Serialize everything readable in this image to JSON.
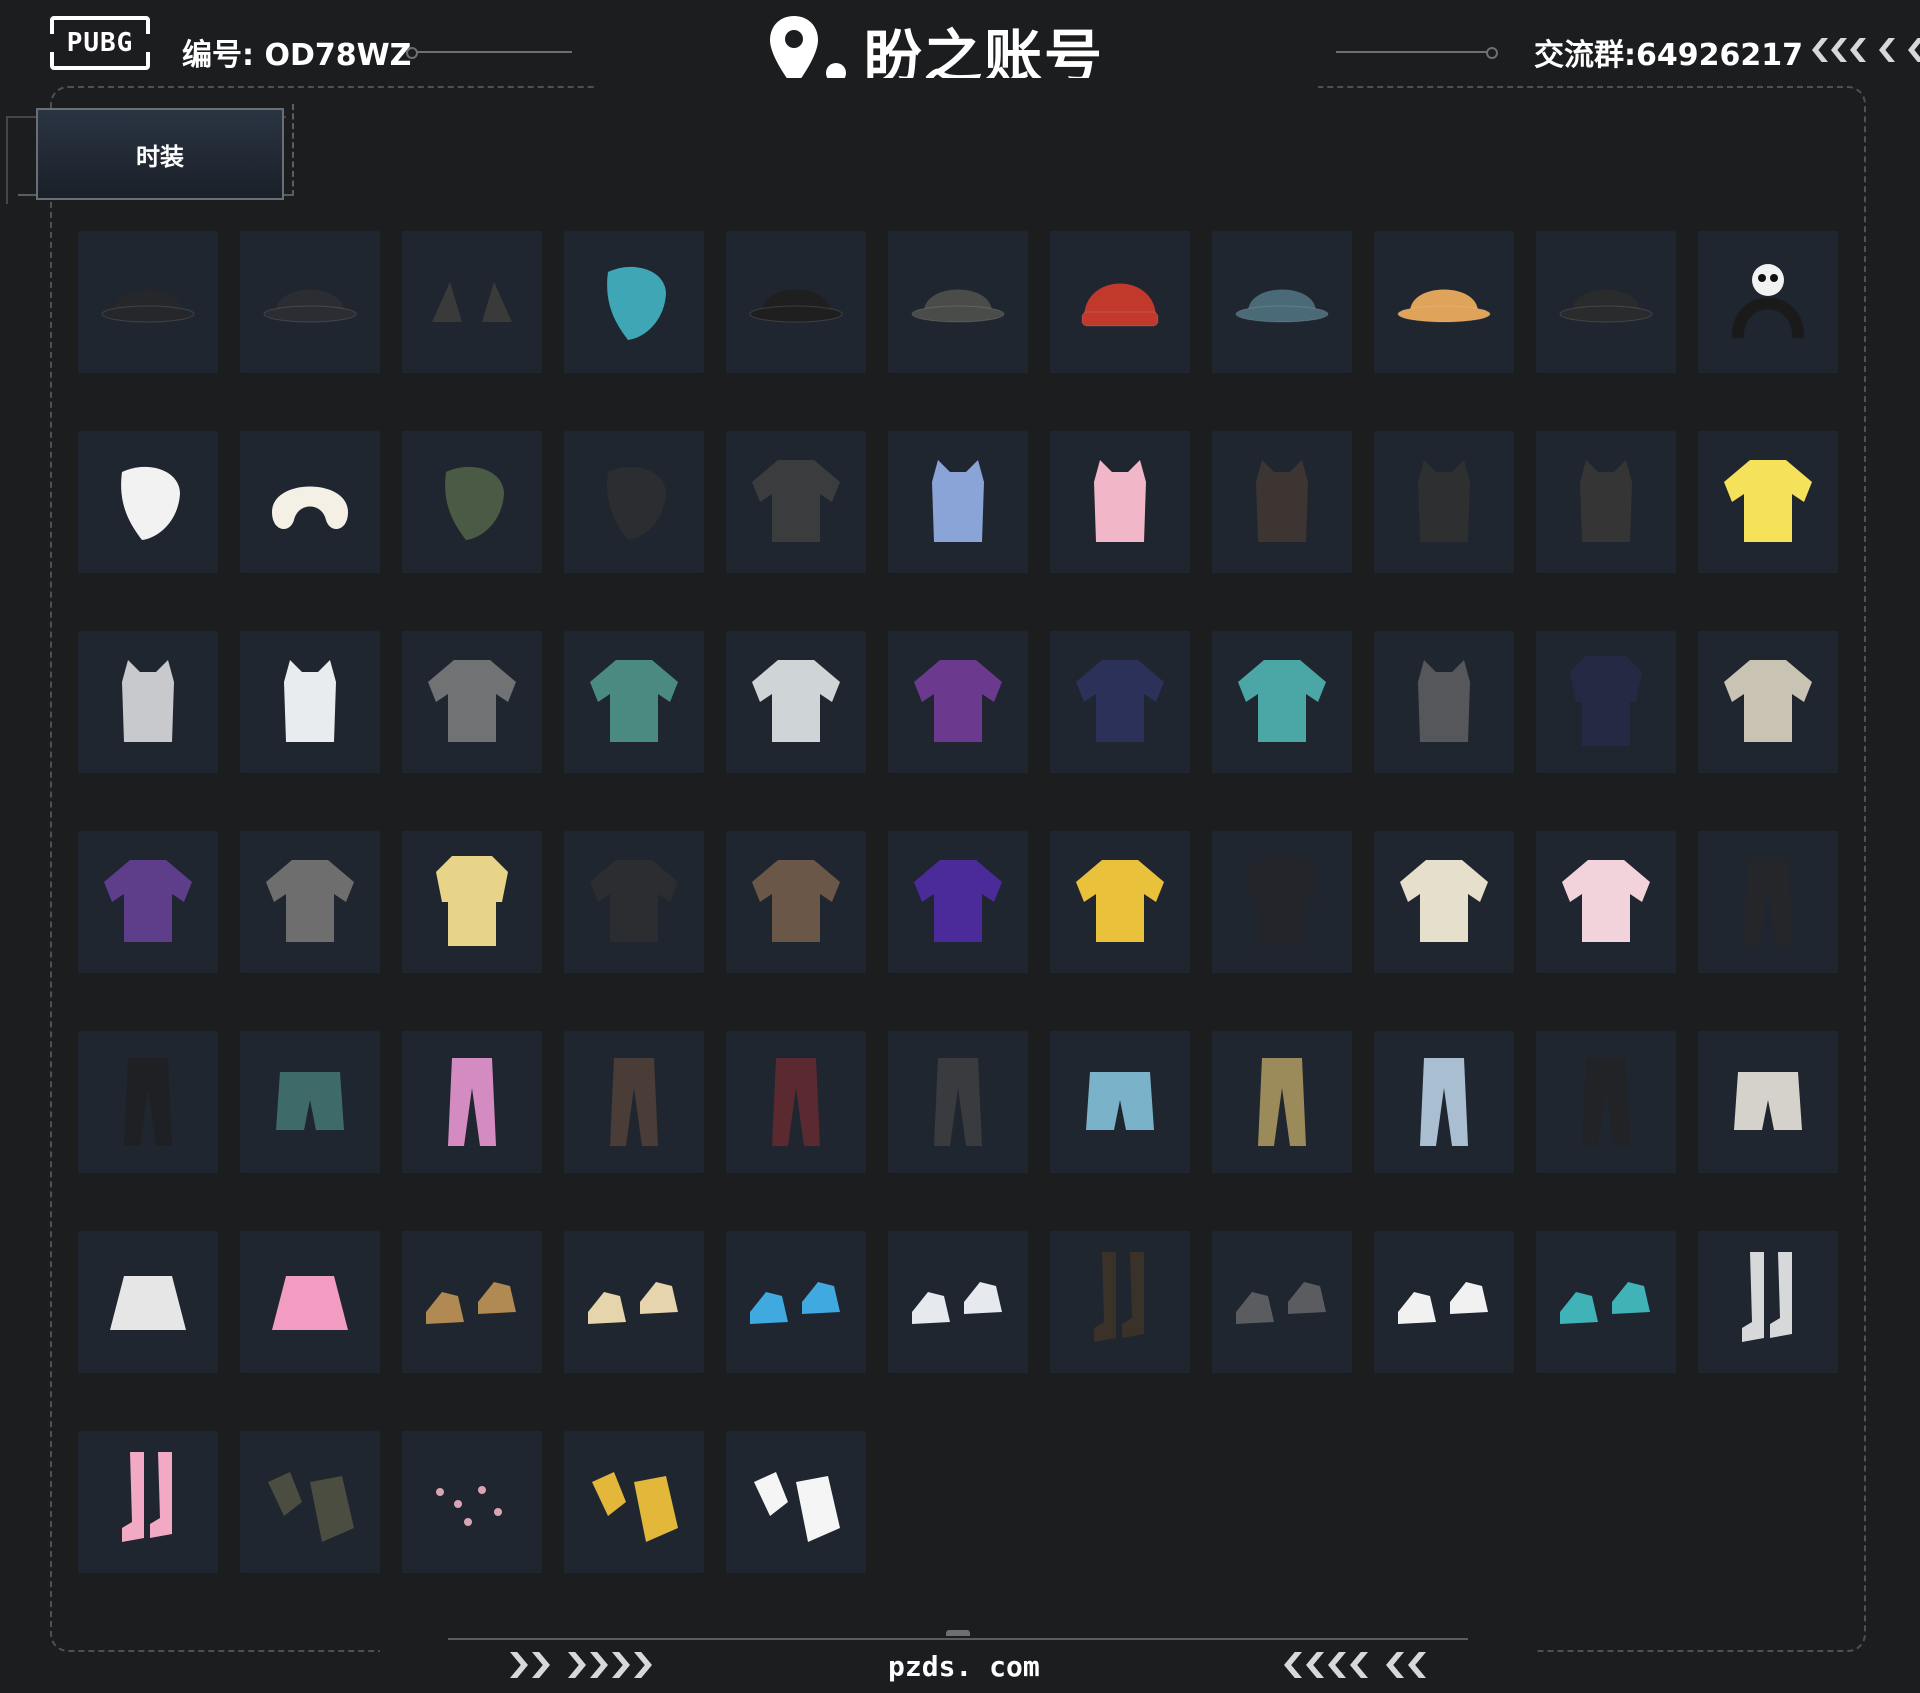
{
  "header": {
    "logo_text": "PUBG",
    "account_id": "编号: OD78WZ",
    "brand_name": "盼之账号",
    "group_info": "交流群:64926217"
  },
  "tabs": [
    {
      "label": "时装",
      "active": true
    }
  ],
  "colors": {
    "background": "#1c1d1f",
    "tile": "#1f262f",
    "frame": "#4e5054",
    "text": "#ffffff"
  },
  "items": [
    {
      "icon": "black-bucket-hat-icon",
      "color": "#26272b"
    },
    {
      "icon": "baseball-helmet-icon",
      "color": "#2b2d33"
    },
    {
      "icon": "cat-ears-icon",
      "color": "#3a3a3a"
    },
    {
      "icon": "dinosaur-mask-icon",
      "color": "#3fa6b5"
    },
    {
      "icon": "black-cap-icon",
      "color": "#1f1f20"
    },
    {
      "icon": "grey-cap-icon",
      "color": "#4a4c4a"
    },
    {
      "icon": "red-beanie-icon",
      "color": "#c0392b"
    },
    {
      "icon": "bucket-hat-icon",
      "color": "#4a6a78"
    },
    {
      "icon": "ice-cream-hat-icon",
      "color": "#e0a35a"
    },
    {
      "icon": "wide-brim-hat-icon",
      "color": "#2a2b2d"
    },
    {
      "icon": "panda-headband-icon",
      "color": "#1a1a1a"
    },
    {
      "icon": "chicken-mask-icon",
      "color": "#f2f2f2"
    },
    {
      "icon": "neck-pillow-icon",
      "color": "#f4f0e6"
    },
    {
      "icon": "camo-mask-icon",
      "color": "#4a5a45"
    },
    {
      "icon": "black-balaclava-icon",
      "color": "#2c2d30"
    },
    {
      "icon": "tattoo-shirt-icon",
      "color": "#3b3c3e"
    },
    {
      "icon": "blue-bra-top-icon",
      "color": "#8aa4d8"
    },
    {
      "icon": "pink-qipao-icon",
      "color": "#f1b6c8"
    },
    {
      "icon": "heart-crop-top-icon",
      "color": "#3d3531"
    },
    {
      "icon": "graphic-vest-icon",
      "color": "#2e2f31"
    },
    {
      "icon": "tank-top-icon",
      "color": "#353535"
    },
    {
      "icon": "yellow-tee-icon",
      "color": "#f5e15a"
    },
    {
      "icon": "sports-bra-icon",
      "color": "#c7c9cc"
    },
    {
      "icon": "basketball-jersey-icon",
      "color": "#e9ecef"
    },
    {
      "icon": "grey-tee-icon",
      "color": "#707274"
    },
    {
      "icon": "floral-shirt-icon",
      "color": "#4a8a80"
    },
    {
      "icon": "white-jacket-icon",
      "color": "#cfd4d6"
    },
    {
      "icon": "purple-jacket-icon",
      "color": "#6b3a8f"
    },
    {
      "icon": "navy-sweatshirt-icon",
      "color": "#2b3158"
    },
    {
      "icon": "teal-hoodie-icon",
      "color": "#4aa7a6"
    },
    {
      "icon": "grey-vest-hoodie-icon",
      "color": "#55575a"
    },
    {
      "icon": "sailor-coat-icon",
      "color": "#252a44"
    },
    {
      "icon": "silver-jacket-icon",
      "color": "#c9c3b4"
    },
    {
      "icon": "varsity-jacket-icon",
      "color": "#5e3d8a"
    },
    {
      "icon": "orange-lined-jacket-icon",
      "color": "#6e6e6e"
    },
    {
      "icon": "yellow-fur-coat-icon",
      "color": "#e8d488"
    },
    {
      "icon": "leather-jacket-icon",
      "color": "#2c2d30"
    },
    {
      "icon": "bronze-jacket-icon",
      "color": "#6b5747"
    },
    {
      "icon": "purple-windbreaker-icon",
      "color": "#4b2a9a"
    },
    {
      "icon": "yellow-white-jacket-icon",
      "color": "#e9c13a"
    },
    {
      "icon": "black-suit-icon",
      "color": "#24252a"
    },
    {
      "icon": "cream-hoodie-icon",
      "color": "#e6dfcc"
    },
    {
      "icon": "pink-hoodie-icon",
      "color": "#f2d3dc"
    },
    {
      "icon": "black-pants-icon",
      "color": "#25262a"
    },
    {
      "icon": "track-pants-icon",
      "color": "#1f2024"
    },
    {
      "icon": "teal-shorts-icon",
      "color": "#3e6b6a"
    },
    {
      "icon": "pink-cargo-pants-icon",
      "color": "#d48bc2"
    },
    {
      "icon": "brown-leggings-icon",
      "color": "#4a3c36"
    },
    {
      "icon": "red-stripe-leggings-icon",
      "color": "#5a2a30"
    },
    {
      "icon": "knee-pad-pants-icon",
      "color": "#3a3b3e"
    },
    {
      "icon": "denim-shorts-icon",
      "color": "#7ab3c9"
    },
    {
      "icon": "camo-pants-icon",
      "color": "#9b8a5a"
    },
    {
      "icon": "ripped-jeans-shorts-icon",
      "color": "#a9bfd1"
    },
    {
      "icon": "black-jeans-icon",
      "color": "#222327"
    },
    {
      "icon": "white-shorts-icon",
      "color": "#d5d2cc"
    },
    {
      "icon": "pleated-skirt-icon",
      "color": "#e6e6e6"
    },
    {
      "icon": "pink-skirt-icon",
      "color": "#f19cc0"
    },
    {
      "icon": "tan-boots-icon",
      "color": "#b08a52"
    },
    {
      "icon": "cream-boots-icon",
      "color": "#e6d5ac"
    },
    {
      "icon": "blue-sole-sneakers-icon",
      "color": "#3fa9e0"
    },
    {
      "icon": "white-sneakers-icon",
      "color": "#e6e9ee"
    },
    {
      "icon": "tall-combat-boots-icon",
      "color": "#3a3128"
    },
    {
      "icon": "orange-lace-shoes-icon",
      "color": "#5a5c60"
    },
    {
      "icon": "red-white-sneakers-icon",
      "color": "#f1f1f1"
    },
    {
      "icon": "teal-clogs-icon",
      "color": "#3fb3b8"
    },
    {
      "icon": "white-tall-boots-icon",
      "color": "#d6d8da"
    },
    {
      "icon": "pink-stockings-icon",
      "color": "#f1a9c4"
    },
    {
      "icon": "tactical-gloves-icon",
      "color": "#4a4d40"
    },
    {
      "icon": "nail-set-icon",
      "color": "#d9a5b5"
    },
    {
      "icon": "yellow-gloves-icon",
      "color": "#e2b73a"
    },
    {
      "icon": "panda-gloves-icon",
      "color": "#f5f5f5"
    }
  ],
  "footer": {
    "url": "pzds. com"
  }
}
